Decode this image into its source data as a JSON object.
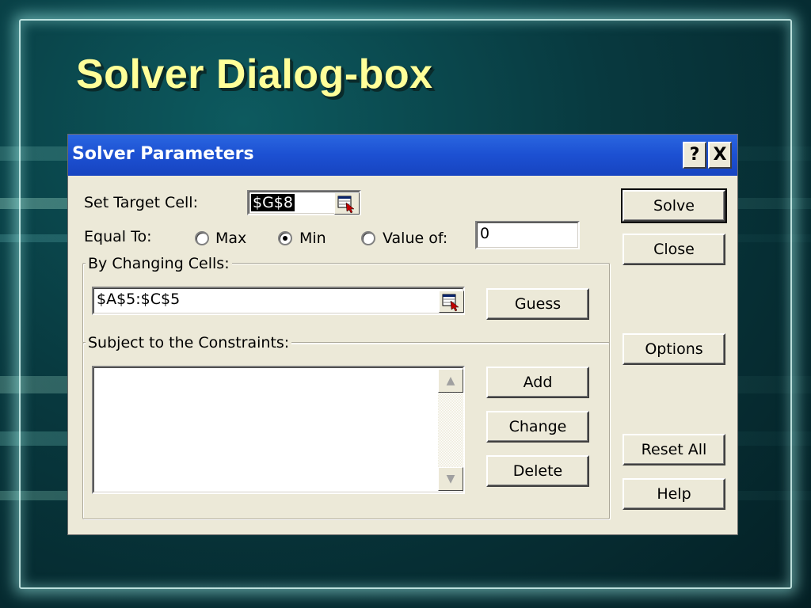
{
  "slide": {
    "title": "Solver Dialog-box"
  },
  "dialog": {
    "title": "Solver Parameters",
    "help_button": "?",
    "close_button": "X",
    "set_target_cell": {
      "label": "Set Target Cell:",
      "value": "$G$8"
    },
    "equal_to": {
      "label": "Equal To:",
      "options": [
        {
          "label": "Max",
          "selected": false
        },
        {
          "label": "Min",
          "selected": true
        },
        {
          "label": "Value of:",
          "selected": false
        }
      ],
      "value_of_input": "0"
    },
    "changing_cells": {
      "label": "By Changing Cells:",
      "value": "$A$5:$C$5",
      "guess_button": "Guess"
    },
    "constraints": {
      "label": "Subject to the Constraints:",
      "items": [],
      "add_button": "Add",
      "change_button": "Change",
      "delete_button": "Delete"
    },
    "buttons": {
      "solve": "Solve",
      "close": "Close",
      "options": "Options",
      "reset_all": "Reset All",
      "help": "Help"
    }
  }
}
